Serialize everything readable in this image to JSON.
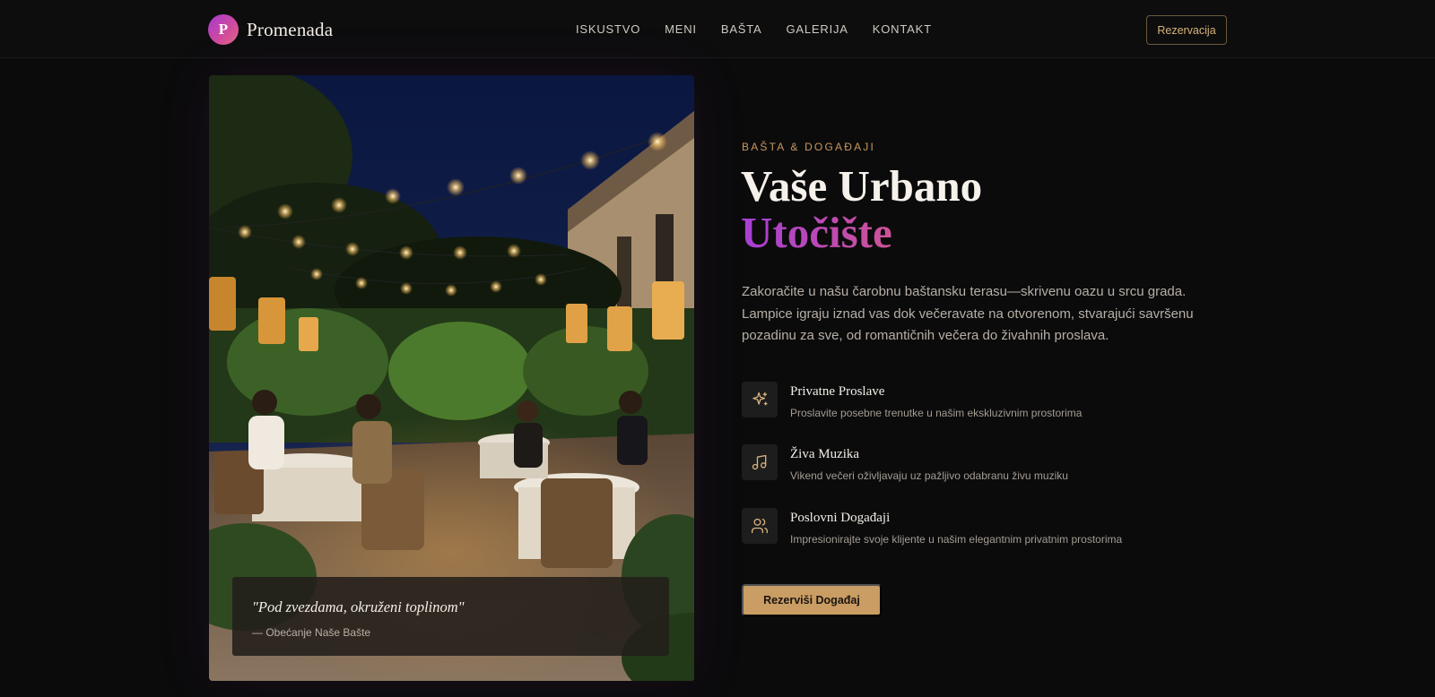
{
  "nav": {
    "logo_letter": "P",
    "brand": "Promenada",
    "links": [
      "ISKUSTVO",
      "MENI",
      "BAŠTA",
      "GALERIJA",
      "KONTAKT"
    ],
    "reserve_label": "Rezervacija"
  },
  "photo": {
    "quote": "\"Pod zvezdama, okruženi toplinom\"",
    "quote_caption": "— Obećanje Naše Bašte"
  },
  "section": {
    "eyebrow": "BAŠTA & DOGAĐAJI",
    "title_line1": "Vaše Urbano",
    "title_line2": "Utočište",
    "description": "Zakoračite u našu čarobnu baštansku terasu—skrivenu oazu u srcu grada. Lampice igraju iznad vas dok večeravate na otvorenom, stvarajući savršenu pozadinu za sve, od romantičnih večera do živahnih proslava.",
    "features": [
      {
        "icon": "sparkles-icon",
        "title": "Privatne Proslave",
        "desc": "Proslavite posebne trenutke u našim ekskluzivnim prostorima"
      },
      {
        "icon": "music-note-icon",
        "title": "Živa Muzika",
        "desc": "Vikend večeri oživljavaju uz pažljivo odabranu živu muziku"
      },
      {
        "icon": "users-icon",
        "title": "Poslovni Događaji",
        "desc": "Impresionirajte svoje klijente u našim elegantnim privatnim prostorima"
      }
    ],
    "cta_label": "Rezerviši Događaj"
  },
  "colors": {
    "background": "#0b0b0c",
    "accent_gold": "#c99d63",
    "gradient_purple": "#a63fd6",
    "gradient_pink": "#e07a85"
  }
}
